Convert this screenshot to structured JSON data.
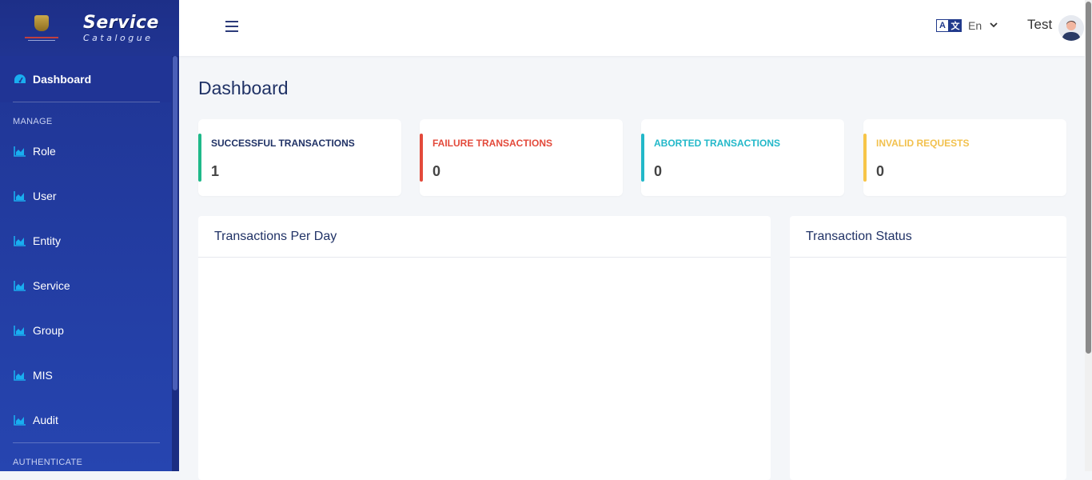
{
  "brand": {
    "title": "Service",
    "subtitle": "Catalogue"
  },
  "sidebar": {
    "active": {
      "label": "Dashboard",
      "icon": "dashboard-icon"
    },
    "sections": [
      {
        "label": "MANAGE"
      },
      {
        "label": "AUTHENTICATE"
      }
    ],
    "items": [
      {
        "label": "Role",
        "icon": "chart-area-icon"
      },
      {
        "label": "User",
        "icon": "chart-area-icon"
      },
      {
        "label": "Entity",
        "icon": "chart-area-icon"
      },
      {
        "label": "Service",
        "icon": "chart-area-icon"
      },
      {
        "label": "Group",
        "icon": "chart-area-icon"
      },
      {
        "label": "MIS",
        "icon": "chart-area-icon"
      },
      {
        "label": "Audit",
        "icon": "chart-area-icon"
      }
    ]
  },
  "topbar": {
    "menu_icon": "hamburger-icon",
    "language": {
      "icon": "translate-icon",
      "glyph_a": "A",
      "glyph_b": "文",
      "label": "En"
    },
    "user": {
      "name": "Test"
    }
  },
  "page": {
    "title": "Dashboard"
  },
  "cards": [
    {
      "title": "SUCCESSFUL TRANSACTIONS",
      "value": "1",
      "color": "#1fb98a",
      "title_color": "#203266"
    },
    {
      "title": "FAILURE TRANSACTIONS",
      "value": "0",
      "color": "#e34a3b",
      "title_color": "#e34a3b"
    },
    {
      "title": "ABORTED TRANSACTIONS",
      "value": "0",
      "color": "#22b8c9",
      "title_color": "#22b8c9"
    },
    {
      "title": "INVALID REQUESTS",
      "value": "0",
      "color": "#f7c548",
      "title_color": "#f2c14e"
    }
  ],
  "panels": [
    {
      "title": "Transactions Per Day"
    },
    {
      "title": "Transaction Status"
    }
  ],
  "colors": {
    "accent": "#203266",
    "sidebar": "#2645b0",
    "icon": "#19aef0"
  }
}
